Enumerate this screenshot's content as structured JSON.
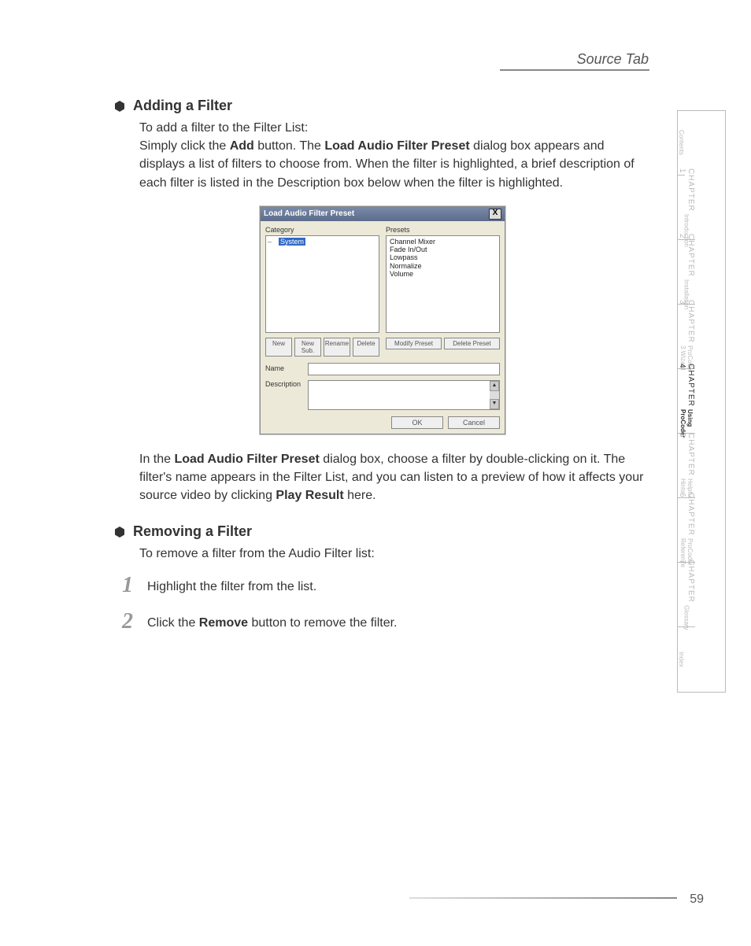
{
  "header": {
    "title": "Source Tab"
  },
  "section1": {
    "title": "Adding a Filter",
    "intro": "To add a filter to the Filter List:",
    "p1_a": "Simply click the ",
    "p1_b": "Add",
    "p1_c": " button. The ",
    "p1_d": "Load Audio Filter Preset",
    "p1_e": " dialog box appears and displays a list of filters to choose from. When the filter is highlighted, a brief description of each filter is listed in the Description box below when the filter is highlighted.",
    "p2_a": "In the ",
    "p2_b": "Load Audio Filter Preset",
    "p2_c": " dialog box, choose a filter by double-clicking on it. The filter's name appears in the Filter List, and you can listen to a preview of how it affects your source video by clicking ",
    "p2_d": "Play Result",
    "p2_e": " here."
  },
  "dialog": {
    "title": "Load Audio Filter Preset",
    "close": "X",
    "category_label": "Category",
    "presets_label": "Presets",
    "tree_item": "System",
    "presets": [
      "Channel Mixer",
      "Fade In/Out",
      "Lowpass",
      "Normalize",
      "Volume"
    ],
    "btns_left": [
      "New",
      "New Sub.",
      "Rename",
      "Delete"
    ],
    "btns_right": [
      "Modify Preset",
      "Delete Preset"
    ],
    "name_label": "Name",
    "desc_label": "Description",
    "ok": "OK",
    "cancel": "Cancel",
    "scroll_up": "▲",
    "scroll_down": "▼"
  },
  "section2": {
    "title": "Removing a Filter",
    "intro": "To remove a filter from the Audio Filter list:",
    "steps": [
      {
        "num": "1",
        "text_a": "Highlight the filter from the list.",
        "text_b": "",
        "text_c": ""
      },
      {
        "num": "2",
        "text_a": "Click the ",
        "text_b": "Remove",
        "text_c": " button to remove the filter."
      }
    ]
  },
  "tabs": [
    {
      "chapter": "",
      "sub": "Contents",
      "active": false
    },
    {
      "chapter": "CHAPTER 1",
      "sub": "Introduction",
      "active": false
    },
    {
      "chapter": "CHAPTER 2",
      "sub": "Installation",
      "active": false
    },
    {
      "chapter": "CHAPTER 3",
      "sub": "ProCoder 3 Wizard",
      "active": false
    },
    {
      "chapter": "CHAPTER 4",
      "sub": "Using ProCoder",
      "active": true
    },
    {
      "chapter": "CHAPTER 5",
      "sub": "Helpful Hints",
      "active": false
    },
    {
      "chapter": "CHAPTER 6",
      "sub": "ProCoder Reference",
      "active": false
    },
    {
      "chapter": "CHAPTER 7",
      "sub": "Glossary",
      "active": false
    },
    {
      "chapter": "",
      "sub": "Index",
      "active": false
    }
  ],
  "page_number": "59"
}
